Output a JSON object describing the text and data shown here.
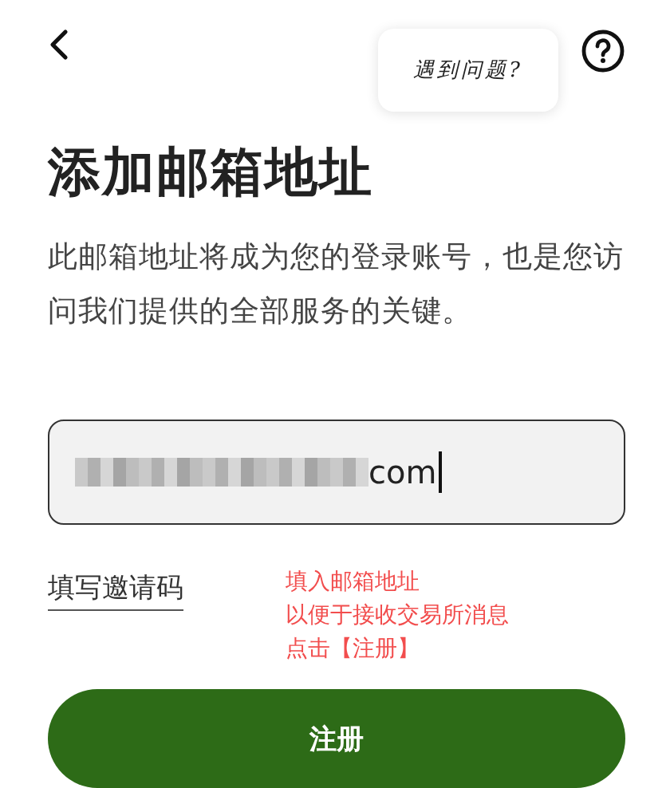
{
  "header": {
    "tooltip": "遇到问题?"
  },
  "title": "添加邮箱地址",
  "description": "此邮箱地址将成为您的登录账号，也是您访问我们提供的全部服务的关键。",
  "email_field": {
    "value": "com"
  },
  "invite_link": "填写邀请码",
  "annotation": [
    "填入邮箱地址",
    "以便于接收交易所消息",
    "点击【注册】"
  ],
  "submit_button": "注册"
}
